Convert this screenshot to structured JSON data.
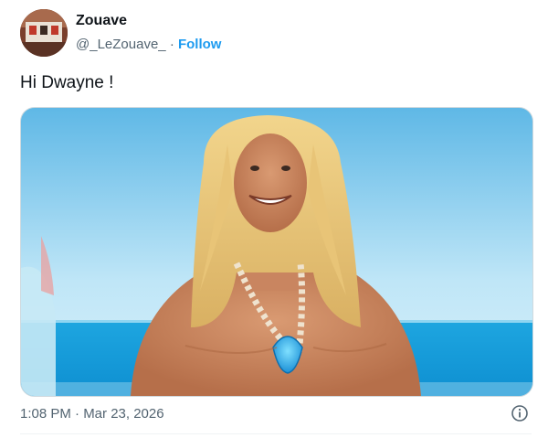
{
  "author": {
    "name": "Zouave",
    "handle": "@_LeZouave_",
    "separator": "·",
    "follow_label": "Follow"
  },
  "tweet": {
    "text": "Hi Dwayne !",
    "timestamp": "1:08 PM · Mar 23, 2026"
  },
  "icons": {
    "info": "info-icon"
  },
  "colors": {
    "accent": "#1d9bf0",
    "secondary_text": "#536471",
    "primary_text": "#0f1419"
  }
}
